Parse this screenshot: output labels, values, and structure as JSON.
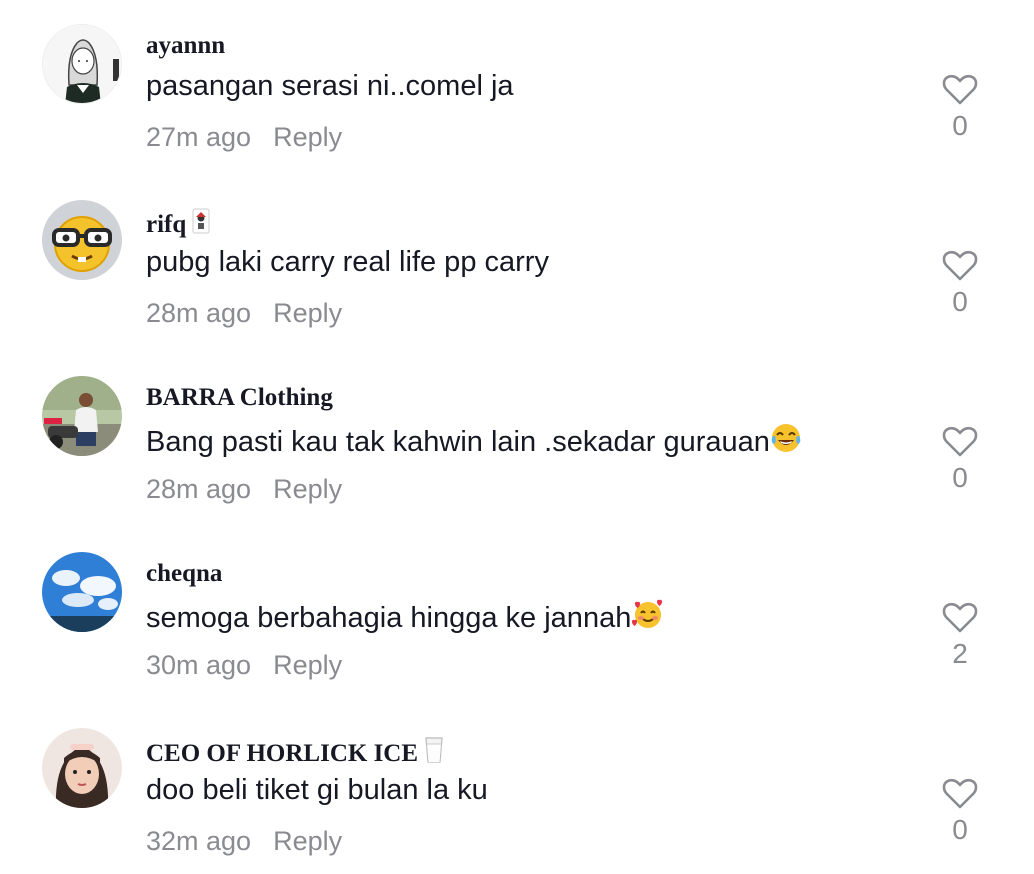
{
  "comments": [
    {
      "username": "ayannn",
      "text": "pasangan serasi ni..comel ja",
      "time": "27m ago",
      "reply_label": "Reply",
      "likes": "0",
      "avatar_icon": "anime-girl-sketch-avatar"
    },
    {
      "username": "rifq",
      "name_icon": "joker-playing-card-icon",
      "text": "pubg laki carry real life pp carry",
      "time": "28m ago",
      "reply_label": "Reply",
      "likes": "0",
      "avatar_icon": "nerd-face-emoji-avatar"
    },
    {
      "username": "BARRA Clothing",
      "text": "Bang pasti kau tak kahwin lain .sekadar gurauan",
      "emoji": "face-with-tears-of-joy",
      "time": "28m ago",
      "reply_label": "Reply",
      "likes": "0",
      "avatar_icon": "man-on-motorbike-photo-avatar"
    },
    {
      "username": "cheqna",
      "text": "semoga berbahagia hingga ke jannah",
      "emoji": "smiling-face-with-hearts",
      "time": "30m ago",
      "reply_label": "Reply",
      "likes": "2",
      "avatar_icon": "blue-sky-clouds-avatar"
    },
    {
      "username": "CEO OF HORLICK ICE",
      "name_icon": "glass-of-milk-icon",
      "text": "doo beli tiket gi bulan la ku",
      "time": "32m ago",
      "reply_label": "Reply",
      "likes": "0",
      "avatar_icon": "girl-selfie-photo-avatar"
    }
  ],
  "colors": {
    "primary_text": "#161823",
    "secondary_text": "#8a8b91",
    "background": "#ffffff"
  }
}
